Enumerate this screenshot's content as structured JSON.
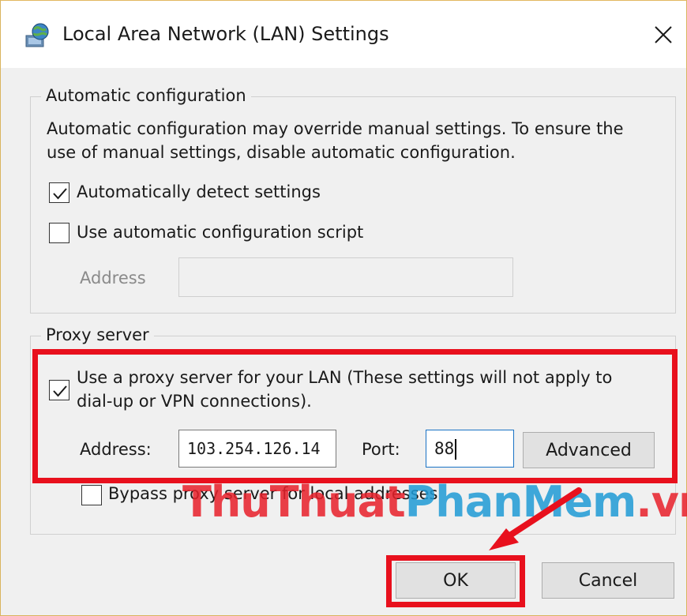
{
  "window": {
    "title": "Local Area Network (LAN) Settings",
    "close_glyph": "✕"
  },
  "auto_config": {
    "legend": "Automatic configuration",
    "description_line1": "Automatic configuration may override manual settings.  To ensure the",
    "description_line2": "use of manual settings, disable automatic configuration.",
    "detect_label": "Automatically detect settings",
    "detect_checked": true,
    "script_label": "Use automatic configuration script",
    "script_checked": false,
    "address_label": "Address",
    "address_value": ""
  },
  "proxy": {
    "legend": "Proxy server",
    "use_proxy_label_line1": "Use a proxy server for your LAN (These settings will not apply to",
    "use_proxy_label_line2": "dial-up or VPN connections).",
    "use_proxy_checked": true,
    "address_label": "Address:",
    "address_value": "103.254.126.14",
    "port_label": "Port:",
    "port_value": "88",
    "advanced_label": "Advanced",
    "bypass_label": "Bypass proxy server for local addresses",
    "bypass_checked": false
  },
  "footer": {
    "ok_label": "OK",
    "cancel_label": "Cancel"
  },
  "watermark": {
    "part1": "ThuThuat",
    "part2": "PhanMem",
    "part3": ".vn"
  },
  "colors": {
    "highlight": "#e8101d",
    "dialog_bg": "#f0f0f0",
    "button_bg": "#e1e1e1"
  },
  "icons": {
    "title": "network-globe-icon",
    "close": "close-icon",
    "check": "checkmark-icon"
  }
}
